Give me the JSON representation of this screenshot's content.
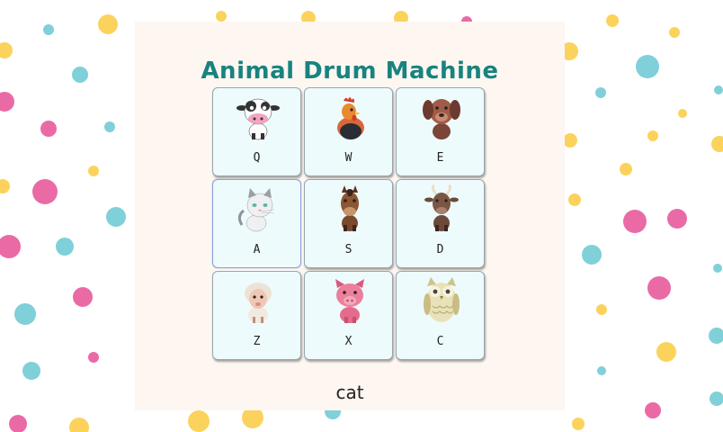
{
  "app": {
    "title": "Animal Drum Machine"
  },
  "pads": [
    {
      "key": "Q",
      "animal": "cow",
      "icon": "cow-icon"
    },
    {
      "key": "W",
      "animal": "rooster",
      "icon": "rooster-icon"
    },
    {
      "key": "E",
      "animal": "dog",
      "icon": "dog-icon"
    },
    {
      "key": "A",
      "animal": "cat",
      "icon": "cat-icon"
    },
    {
      "key": "S",
      "animal": "horse",
      "icon": "horse-icon"
    },
    {
      "key": "D",
      "animal": "goat",
      "icon": "goat-icon"
    },
    {
      "key": "Z",
      "animal": "sheep",
      "icon": "sheep-icon"
    },
    {
      "key": "X",
      "animal": "pig",
      "icon": "pig-icon"
    },
    {
      "key": "C",
      "animal": "owl",
      "icon": "owl-icon"
    }
  ],
  "display": {
    "current_sound": "cat"
  },
  "colors": {
    "title": "#18837f",
    "panel": "#fdf6f1",
    "pad": "#eefbfc",
    "dot_yellow": "#fbd35c",
    "dot_pink": "#ea6aa6",
    "dot_blue": "#7fd0d9"
  }
}
